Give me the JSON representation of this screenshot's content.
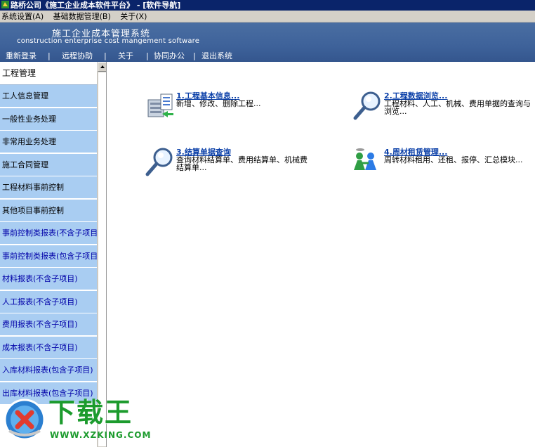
{
  "window": {
    "title": "路桥公司《施工企业成本软件平台》 - [软件导航]"
  },
  "menubar": {
    "items": [
      "系统设置(A)",
      "基础数据管理(B)",
      "关于(X)"
    ]
  },
  "banner": {
    "title_cn": "施工企业成本管理系统",
    "title_en": "construction enterprise cost mangement software"
  },
  "toolbar": {
    "items": [
      "重新登录",
      "远程协助",
      "关于",
      "协同办公",
      "退出系统"
    ],
    "separator": "|"
  },
  "sidebar": {
    "header": "工程管理",
    "items": [
      {
        "label": "工人信息管理"
      },
      {
        "label": "一般性业务处理"
      },
      {
        "label": "非常用业务处理"
      },
      {
        "label": "施工合同管理"
      },
      {
        "label": "工程材料事前控制"
      },
      {
        "label": "其他项目事前控制"
      },
      {
        "label": "事前控制类报表(不含子项目)"
      },
      {
        "label": "事前控制类报表(包含子项目)"
      },
      {
        "label": "材料报表(不含子项目)"
      },
      {
        "label": "人工报表(不含子项目)"
      },
      {
        "label": "费用报表(不含子项目)"
      },
      {
        "label": "成本报表(不含子项目)"
      },
      {
        "label": "入库材料报表(包含子项目)"
      },
      {
        "label": "出库材料报表(包含子项目)"
      }
    ]
  },
  "functions": [
    {
      "title": "1.工程基本信息...",
      "desc": "新增、修改、删除工程...",
      "icon": "project-info-icon"
    },
    {
      "title": "2.工程数据浏览...",
      "desc": "工程材料、人工、机械、费用单据的查询与浏览...",
      "icon": "magnifier-icon"
    },
    {
      "title": "3.结算单据查询",
      "desc": "查询材料结算单、费用结算单、机械费结算单...",
      "icon": "magnifier-icon"
    },
    {
      "title": "4.周材租赁管理...",
      "desc": "周转材料租用、还租、报停、汇总模块...",
      "icon": "people-icon"
    }
  ],
  "watermark": {
    "name": "下载王",
    "url": "WWW.XZKING.COM"
  },
  "colors": {
    "title_bar": "#0a246a",
    "banner": "#3e629a",
    "sidebar_item": "#a9cdf2",
    "link": "#0a3fa8",
    "watermark_green": "#1c9b2d"
  }
}
